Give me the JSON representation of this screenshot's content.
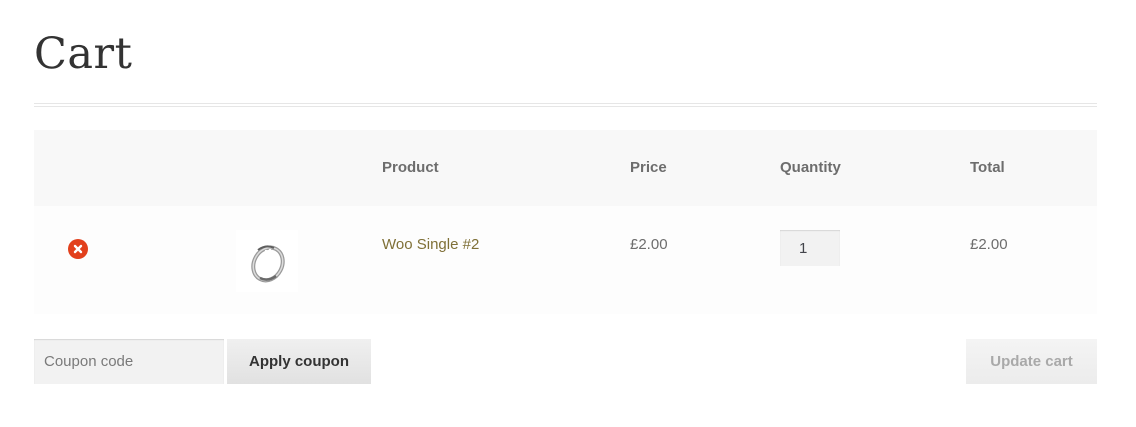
{
  "page": {
    "title": "Cart"
  },
  "table": {
    "headers": {
      "product": "Product",
      "price": "Price",
      "quantity": "Quantity",
      "total": "Total"
    },
    "rows": [
      {
        "product_name": "Woo Single #2",
        "price": "£2.00",
        "quantity": "1",
        "total": "£2.00",
        "thumbnail_icon": "ring-thumbnail",
        "remove_icon": "remove-circle-x-icon"
      }
    ]
  },
  "actions": {
    "coupon_placeholder": "Coupon code",
    "apply_coupon_label": "Apply coupon",
    "update_cart_label": "Update cart"
  },
  "colors": {
    "accent_link": "#7f7037",
    "remove_red": "#e2401c",
    "header_bg": "#f8f8f8"
  }
}
